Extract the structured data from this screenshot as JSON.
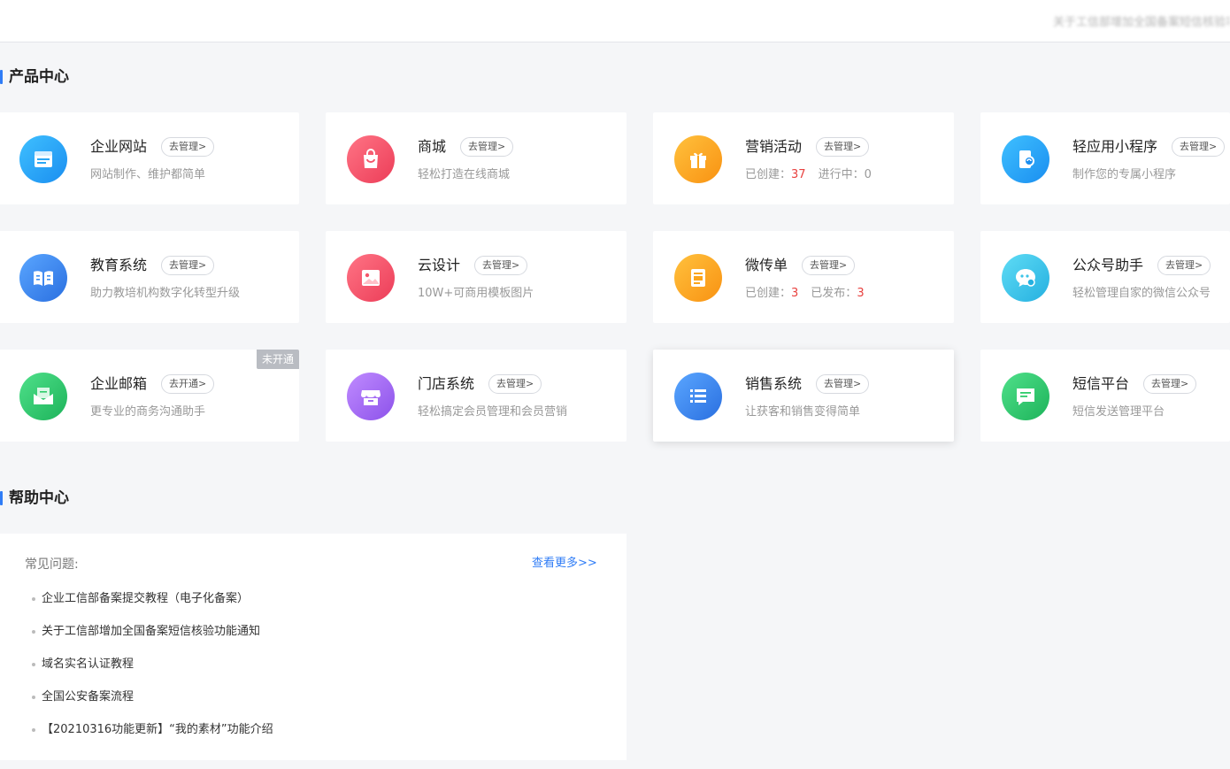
{
  "topbar": {
    "notice": "关于工信部增加全国备案短信核验功能、三年服务"
  },
  "product_center": {
    "title": "产品中心",
    "cards": [
      {
        "name": "企业网站",
        "button": "去管理>",
        "desc": "网站制作、维护都简单",
        "icon": "website-icon",
        "color": "#2aa7f5"
      },
      {
        "name": "商城",
        "button": "去管理>",
        "desc": "轻松打造在线商城",
        "icon": "shopping-bag-icon",
        "color": "#f4566b"
      },
      {
        "name": "营销活动",
        "button": "去管理>",
        "stats": {
          "created_label": "已创建：",
          "created": "37",
          "ongoing_label": "进行中：",
          "ongoing": "0"
        },
        "icon": "gift-icon",
        "color": "#fba51b"
      },
      {
        "name": "轻应用小程序",
        "button": "去管理>",
        "desc": "制作您的专属小程序",
        "icon": "mini-program-icon",
        "color": "#2aa7f5"
      },
      {
        "name": "教育系统",
        "button": "去管理>",
        "desc": "助力教培机构数字化转型升级",
        "icon": "book-icon",
        "color": "#3d8ef2"
      },
      {
        "name": "云设计",
        "button": "去管理>",
        "desc": "10W+可商用模板图片",
        "icon": "image-icon",
        "color": "#f4566b"
      },
      {
        "name": "微传单",
        "button": "去管理>",
        "stats": {
          "created_label": "已创建：",
          "created": "3",
          "published_label": "已发布：",
          "published": "3"
        },
        "icon": "flyer-icon",
        "color": "#fba51b"
      },
      {
        "name": "公众号助手",
        "button": "去管理>",
        "desc": "轻松管理自家的微信公众号",
        "icon": "chat-bubble-icon",
        "color": "#3cc4e8"
      },
      {
        "name": "企业邮箱",
        "button": "去开通>",
        "desc": "更专业的商务沟通助手",
        "tag": "未开通",
        "icon": "mail-icon",
        "color": "#2ecb6a"
      },
      {
        "name": "门店系统",
        "button": "去管理>",
        "desc": "轻松搞定会员管理和会员营销",
        "icon": "store-icon",
        "color": "#a46df2"
      },
      {
        "name": "销售系统",
        "button": "去管理>",
        "desc": "让获客和销售变得简单",
        "icon": "list-icon",
        "color": "#3d8ef2"
      },
      {
        "name": "短信平台",
        "button": "去管理>",
        "desc": "短信发送管理平台",
        "icon": "sms-icon",
        "color": "#2ecb6a"
      }
    ]
  },
  "help_center": {
    "title": "帮助中心",
    "faq_label": "常见问题:",
    "more_link": "查看更多>>",
    "items": [
      "企业工信部备案提交教程（电子化备案）",
      "关于工信部增加全国备案短信核验功能通知",
      "域名实名认证教程",
      "全国公安备案流程",
      "【20210316功能更新】“我的素材”功能介绍"
    ]
  }
}
